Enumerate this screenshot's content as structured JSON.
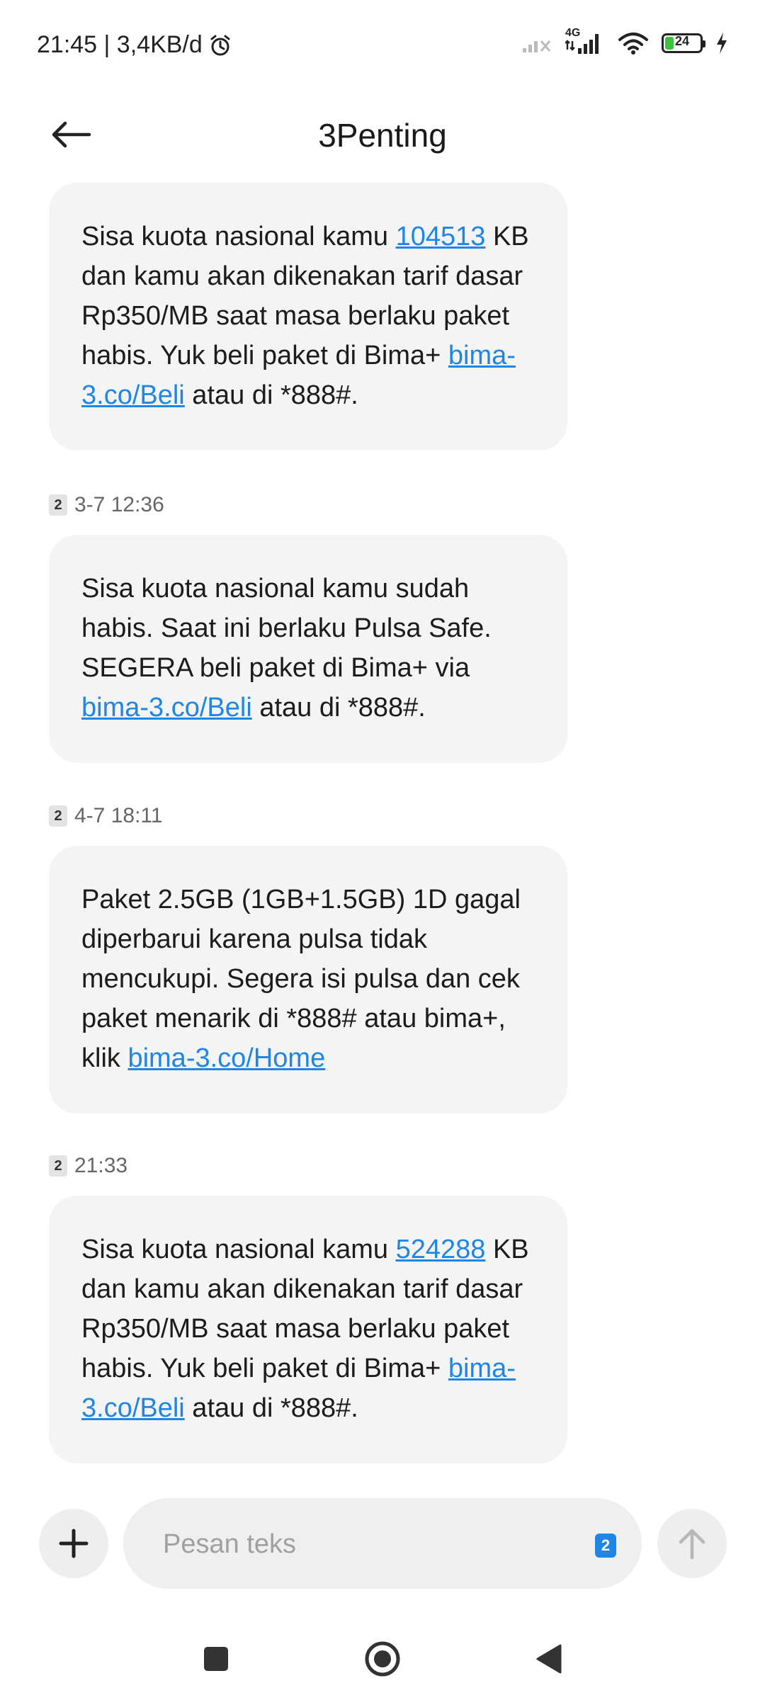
{
  "status_bar": {
    "time_speed": "21:45 | 3,4KB/d",
    "network_label": "4G",
    "battery_level": "24",
    "icons": [
      "alarm-icon",
      "signal-off-icon",
      "signal-4g-icon",
      "wifi-icon",
      "battery-icon",
      "charging-icon"
    ]
  },
  "header": {
    "title": "3Penting"
  },
  "messages": [
    {
      "sim": "",
      "time": "",
      "parts": {
        "t1": "Sisa kuota nasional kamu ",
        "link1": "104513",
        "t2": " KB dan kamu akan dikenakan tarif dasar Rp350/MB saat masa berlaku paket habis. Yuk beli paket di Bima+ ",
        "link2": "bima-3.co/Beli",
        "t3": " atau di *888#."
      }
    },
    {
      "sim": "2",
      "time": "3-7 12:36",
      "parts": {
        "t1": "Sisa kuota nasional kamu sudah habis. Saat ini berlaku Pulsa Safe. SEGERA beli paket di Bima+ via ",
        "link1": "bima-3.co/Beli",
        "t2": " atau di *888#."
      }
    },
    {
      "sim": "2",
      "time": "4-7 18:11",
      "parts": {
        "t1": "Paket 2.5GB (1GB+1.5GB) 1D gagal diperbarui karena pulsa tidak mencukupi. Segera isi pulsa dan cek paket menarik di *888# atau bima+, klik ",
        "link1": "bima-3.co/Home"
      }
    },
    {
      "sim": "2",
      "time": "21:33",
      "parts": {
        "t1": "Sisa kuota nasional kamu ",
        "link1": "524288",
        "t2": " KB dan kamu akan dikenakan tarif dasar Rp350/MB saat masa berlaku paket habis. Yuk beli paket di Bima+ ",
        "link2": "bima-3.co/Beli",
        "t3": " atau di *888#."
      }
    }
  ],
  "composer": {
    "placeholder": "Pesan teks",
    "sim_selected": "2"
  },
  "colors": {
    "link": "#1f86e5",
    "bubble": "#f4f4f4",
    "sim_badge_active": "#1f86e5",
    "battery_fill": "#3cc33c"
  }
}
